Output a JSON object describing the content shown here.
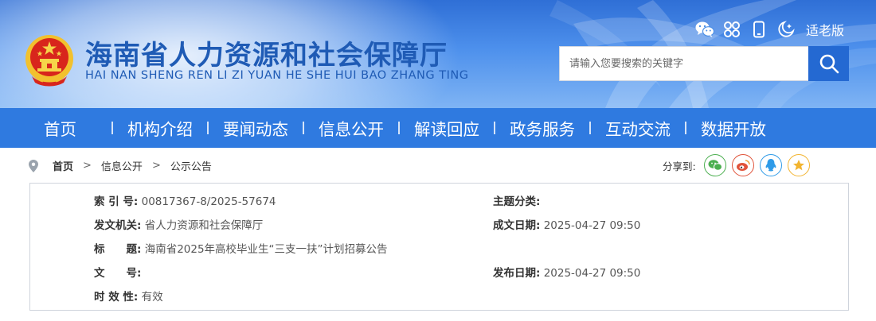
{
  "header": {
    "title_cn": "海南省人力资源和社会保障厅",
    "title_en": "HAI NAN SHENG REN LI ZI YUAN HE SHE HUI BAO ZHANG TING",
    "tools": [
      {
        "icon": "wechat-icon"
      },
      {
        "icon": "apps-icon"
      },
      {
        "icon": "mobile-icon"
      },
      {
        "icon": "night-mode-icon"
      }
    ],
    "elder_label": "适老版",
    "search": {
      "placeholder": "请输入您要搜索的关键字",
      "value": ""
    },
    "colors": {
      "brand_blue": "#1f5bb5",
      "search_button": "#2469d2"
    }
  },
  "nav": {
    "items": [
      "首页",
      "机构介绍",
      "要闻动态",
      "信息公开",
      "解读回应",
      "政务服务",
      "互动交流",
      "数据开放"
    ],
    "background": "#2f7ae0"
  },
  "breadcrumb": {
    "items": [
      "首页",
      "信息公开",
      "公示公告"
    ],
    "separator": ">"
  },
  "share": {
    "label": "分享到:",
    "targets": [
      {
        "icon": "wechat-share-icon",
        "color": "#4caf50"
      },
      {
        "icon": "weibo-icon",
        "color": "#e0533a"
      },
      {
        "icon": "qq-icon",
        "color": "#2f9be8"
      },
      {
        "icon": "qzone-icon",
        "color": "#f2b430"
      }
    ]
  },
  "info": {
    "index_label": "索 引 号:",
    "index_value": "00817367-8/2025-57674",
    "category_label": "主题分类:",
    "category_value": "",
    "issuer_label": "发文机关:",
    "issuer_value": "省人力资源和社会保障厅",
    "created_label": "成文日期:",
    "created_value": "2025-04-27 09:50",
    "title_label": "标　　题:",
    "title_value": "海南省2025年高校毕业生“三支一扶”计划招募公告",
    "docno_label": "文　　号:",
    "docno_value": "",
    "published_label": "发布日期:",
    "published_value": "2025-04-27 09:50",
    "validity_label": "时 效 性:",
    "validity_value": "有效"
  }
}
